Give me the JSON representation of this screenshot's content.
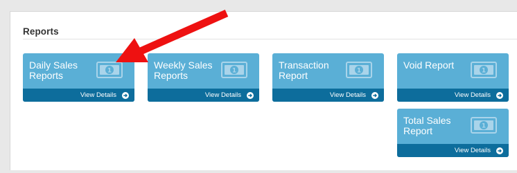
{
  "panel": {
    "title": "Reports"
  },
  "tiles": [
    {
      "label": "Daily Sales Reports",
      "footer": "View Details",
      "icon": "money-icon"
    },
    {
      "label": "Weekly Sales Reports",
      "footer": "View Details",
      "icon": "money-icon"
    },
    {
      "label": "Transaction Report",
      "footer": "View Details",
      "icon": "money-icon"
    },
    {
      "label": "Void Report",
      "footer": "View Details",
      "icon": "money-icon"
    },
    {
      "label": "Total Sales Report",
      "footer": "View Details",
      "icon": "money-icon"
    }
  ],
  "annotation": {
    "arrow_color": "#ee1111",
    "icon": "annotation-arrow"
  },
  "colors": {
    "tile": "#5aafd6",
    "tile_footer": "#0d6d9c"
  }
}
